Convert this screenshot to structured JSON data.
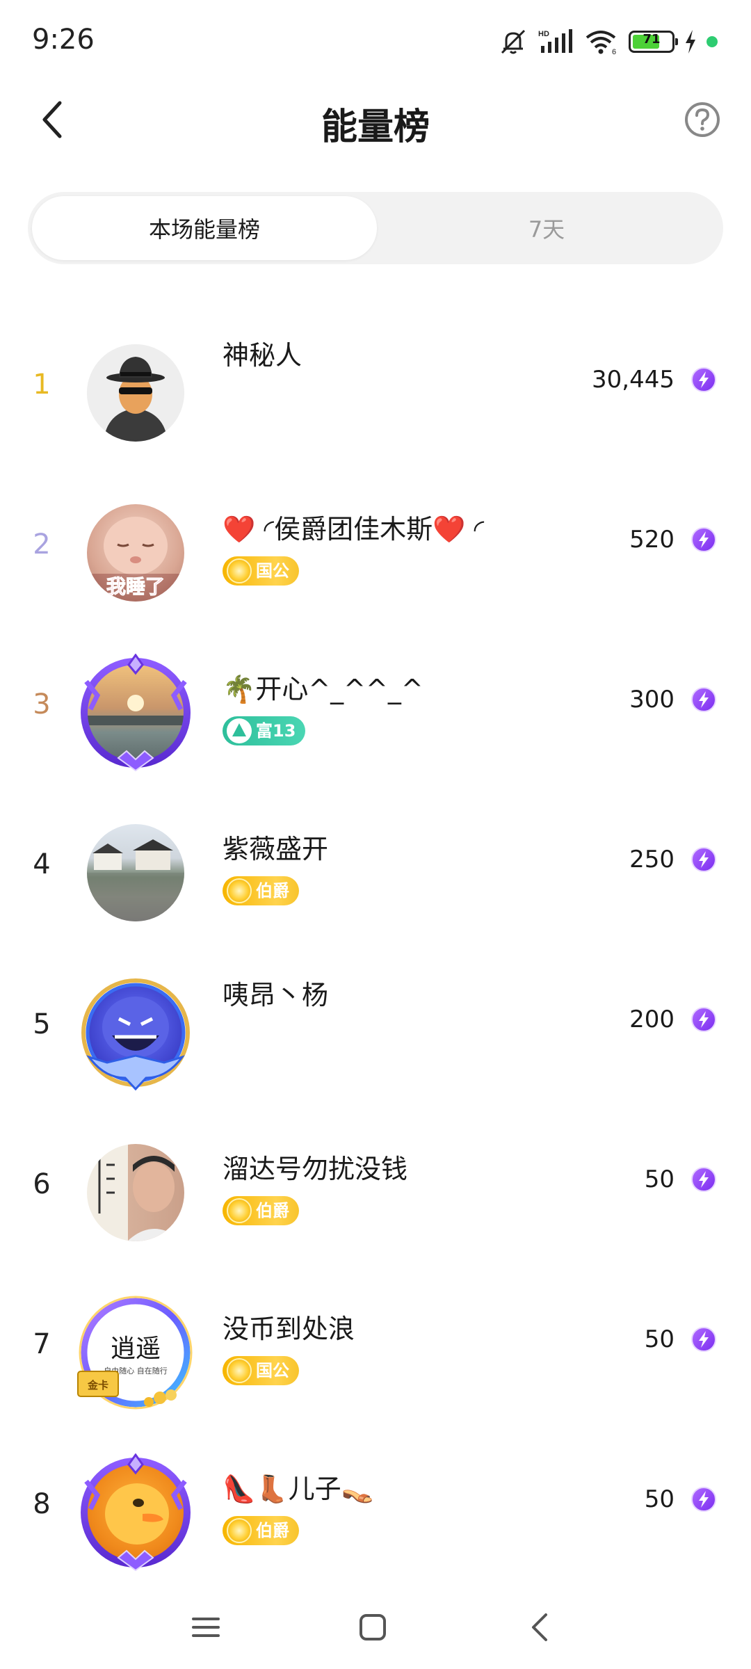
{
  "status_bar": {
    "time": "9:26",
    "battery_level": "71",
    "icons": [
      "mute-icon",
      "hd-signal-icon",
      "wifi-icon",
      "battery-icon",
      "charging-icon",
      "dot-icon"
    ]
  },
  "header": {
    "title": "能量榜",
    "back_icon": "chevron-left-icon",
    "help_icon": "help-circle-icon"
  },
  "tabs": [
    {
      "label": "本场能量榜",
      "active": true
    },
    {
      "label": "7天",
      "active": false
    }
  ],
  "ranking": [
    {
      "rank": "1",
      "name": "神秘人",
      "badge": null,
      "score": "30,445"
    },
    {
      "rank": "2",
      "name": "❤️ ◜侯爵团佳木斯❤️ ◜",
      "badge": {
        "label": "国公",
        "style": "gold"
      },
      "score": "520"
    },
    {
      "rank": "3",
      "name": "🌴开心^_^^_^",
      "badge": {
        "label": "富13",
        "style": "green"
      },
      "score": "300"
    },
    {
      "rank": "4",
      "name": "紫薇盛开",
      "badge": {
        "label": "伯爵",
        "style": "gold"
      },
      "score": "250"
    },
    {
      "rank": "5",
      "name": "咦昂丶杨",
      "badge": null,
      "score": "200"
    },
    {
      "rank": "6",
      "name": "溜达号勿扰没钱",
      "badge": {
        "label": "伯爵",
        "style": "gold"
      },
      "score": "50"
    },
    {
      "rank": "7",
      "name": "没币到处浪",
      "badge": {
        "label": "国公",
        "style": "gold"
      },
      "score": "50"
    },
    {
      "rank": "8",
      "name": "👠👢儿子👡",
      "badge": {
        "label": "伯爵",
        "style": "gold"
      },
      "score": "50"
    }
  ],
  "avatar_text": {
    "row2": "我睡了",
    "row7": "逍遥",
    "row7_sub": "自由随心 自在随行",
    "row7_card": "金卡"
  },
  "nav_bar": {
    "items": [
      "menu-icon",
      "home-square-icon",
      "back-chevron-icon"
    ]
  },
  "colors": {
    "accent_purple": "#8e44ff",
    "rank1": "#e8b923",
    "rank2": "#a9a3e0",
    "rank3": "#c58a5a",
    "badge_gold": "#f7b500",
    "badge_green": "#2ebf9b"
  }
}
